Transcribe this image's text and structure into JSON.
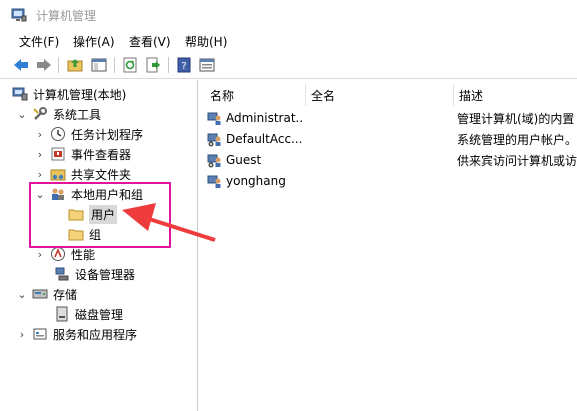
{
  "window": {
    "title": "计算机管理"
  },
  "menu": [
    "文件(F)",
    "操作(A)",
    "查看(V)",
    "帮助(H)"
  ],
  "toolbar": [
    "back-icon",
    "forward-icon",
    "up-folder-icon",
    "show-tree-icon",
    "refresh-icon",
    "export-icon",
    "help-icon",
    "properties-icon"
  ],
  "tree": {
    "root": "计算机管理(本地)",
    "system_tools": "系统工具",
    "task_scheduler": "任务计划程序",
    "event_viewer": "事件查看器",
    "shared_folders": "共享文件夹",
    "local_users_groups": "本地用户和组",
    "users": "用户",
    "groups": "组",
    "performance": "性能",
    "device_manager": "设备管理器",
    "storage": "存储",
    "disk_management": "磁盘管理",
    "services_apps": "服务和应用程序"
  },
  "columns": {
    "name": "名称",
    "fullname": "全名",
    "description": "描述"
  },
  "users": [
    {
      "name": "Administrat...",
      "fullname": "",
      "description": "管理计算机(域)的内置"
    },
    {
      "name": "DefaultAcc...",
      "fullname": "",
      "description": "系统管理的用户帐户。"
    },
    {
      "name": "Guest",
      "fullname": "",
      "description": "供来宾访问计算机或访"
    },
    {
      "name": "yonghang",
      "fullname": "",
      "description": ""
    }
  ],
  "colors": {
    "highlight": "#e0149a",
    "arrow": "#ee3b3b"
  }
}
